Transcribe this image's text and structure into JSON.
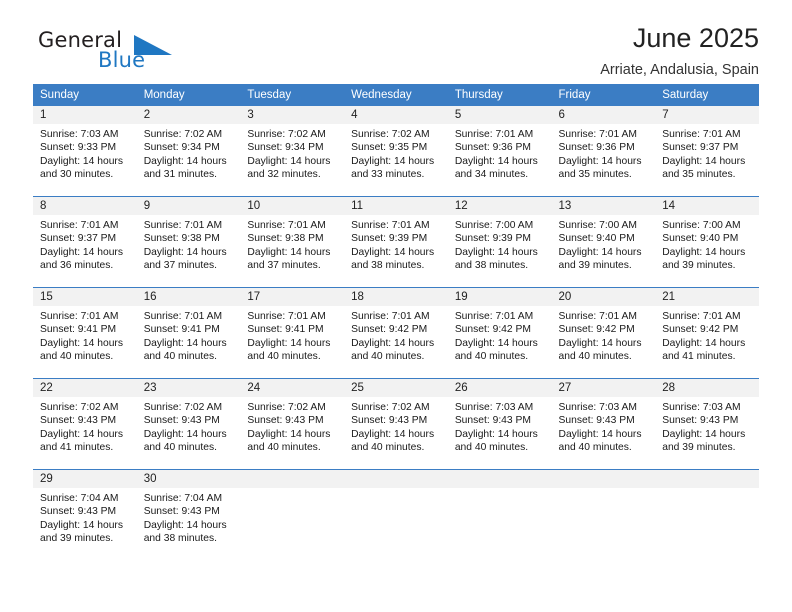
{
  "brand": {
    "name_part1": "General",
    "name_part2": "Blue",
    "triangle_color": "#1f77c2",
    "text_color": "#231f20"
  },
  "header": {
    "title": "June 2025",
    "subtitle": "Arriate, Andalusia, Spain"
  },
  "theme": {
    "header_bg": "#3b7dc4",
    "header_text": "#ffffff",
    "daynum_bg": "#f2f2f2",
    "row_divider": "#3b7dc4"
  },
  "weekdays": [
    "Sunday",
    "Monday",
    "Tuesday",
    "Wednesday",
    "Thursday",
    "Friday",
    "Saturday"
  ],
  "labels": {
    "sunrise_prefix": "Sunrise:",
    "sunset_prefix": "Sunset:",
    "daylight_prefix": "Daylight:"
  },
  "weeks": [
    [
      {
        "day": "1",
        "sunrise": "Sunrise: 7:03 AM",
        "sunset": "Sunset: 9:33 PM",
        "daylight_line1": "Daylight: 14 hours",
        "daylight_line2": "and 30 minutes."
      },
      {
        "day": "2",
        "sunrise": "Sunrise: 7:02 AM",
        "sunset": "Sunset: 9:34 PM",
        "daylight_line1": "Daylight: 14 hours",
        "daylight_line2": "and 31 minutes."
      },
      {
        "day": "3",
        "sunrise": "Sunrise: 7:02 AM",
        "sunset": "Sunset: 9:34 PM",
        "daylight_line1": "Daylight: 14 hours",
        "daylight_line2": "and 32 minutes."
      },
      {
        "day": "4",
        "sunrise": "Sunrise: 7:02 AM",
        "sunset": "Sunset: 9:35 PM",
        "daylight_line1": "Daylight: 14 hours",
        "daylight_line2": "and 33 minutes."
      },
      {
        "day": "5",
        "sunrise": "Sunrise: 7:01 AM",
        "sunset": "Sunset: 9:36 PM",
        "daylight_line1": "Daylight: 14 hours",
        "daylight_line2": "and 34 minutes."
      },
      {
        "day": "6",
        "sunrise": "Sunrise: 7:01 AM",
        "sunset": "Sunset: 9:36 PM",
        "daylight_line1": "Daylight: 14 hours",
        "daylight_line2": "and 35 minutes."
      },
      {
        "day": "7",
        "sunrise": "Sunrise: 7:01 AM",
        "sunset": "Sunset: 9:37 PM",
        "daylight_line1": "Daylight: 14 hours",
        "daylight_line2": "and 35 minutes."
      }
    ],
    [
      {
        "day": "8",
        "sunrise": "Sunrise: 7:01 AM",
        "sunset": "Sunset: 9:37 PM",
        "daylight_line1": "Daylight: 14 hours",
        "daylight_line2": "and 36 minutes."
      },
      {
        "day": "9",
        "sunrise": "Sunrise: 7:01 AM",
        "sunset": "Sunset: 9:38 PM",
        "daylight_line1": "Daylight: 14 hours",
        "daylight_line2": "and 37 minutes."
      },
      {
        "day": "10",
        "sunrise": "Sunrise: 7:01 AM",
        "sunset": "Sunset: 9:38 PM",
        "daylight_line1": "Daylight: 14 hours",
        "daylight_line2": "and 37 minutes."
      },
      {
        "day": "11",
        "sunrise": "Sunrise: 7:01 AM",
        "sunset": "Sunset: 9:39 PM",
        "daylight_line1": "Daylight: 14 hours",
        "daylight_line2": "and 38 minutes."
      },
      {
        "day": "12",
        "sunrise": "Sunrise: 7:00 AM",
        "sunset": "Sunset: 9:39 PM",
        "daylight_line1": "Daylight: 14 hours",
        "daylight_line2": "and 38 minutes."
      },
      {
        "day": "13",
        "sunrise": "Sunrise: 7:00 AM",
        "sunset": "Sunset: 9:40 PM",
        "daylight_line1": "Daylight: 14 hours",
        "daylight_line2": "and 39 minutes."
      },
      {
        "day": "14",
        "sunrise": "Sunrise: 7:00 AM",
        "sunset": "Sunset: 9:40 PM",
        "daylight_line1": "Daylight: 14 hours",
        "daylight_line2": "and 39 minutes."
      }
    ],
    [
      {
        "day": "15",
        "sunrise": "Sunrise: 7:01 AM",
        "sunset": "Sunset: 9:41 PM",
        "daylight_line1": "Daylight: 14 hours",
        "daylight_line2": "and 40 minutes."
      },
      {
        "day": "16",
        "sunrise": "Sunrise: 7:01 AM",
        "sunset": "Sunset: 9:41 PM",
        "daylight_line1": "Daylight: 14 hours",
        "daylight_line2": "and 40 minutes."
      },
      {
        "day": "17",
        "sunrise": "Sunrise: 7:01 AM",
        "sunset": "Sunset: 9:41 PM",
        "daylight_line1": "Daylight: 14 hours",
        "daylight_line2": "and 40 minutes."
      },
      {
        "day": "18",
        "sunrise": "Sunrise: 7:01 AM",
        "sunset": "Sunset: 9:42 PM",
        "daylight_line1": "Daylight: 14 hours",
        "daylight_line2": "and 40 minutes."
      },
      {
        "day": "19",
        "sunrise": "Sunrise: 7:01 AM",
        "sunset": "Sunset: 9:42 PM",
        "daylight_line1": "Daylight: 14 hours",
        "daylight_line2": "and 40 minutes."
      },
      {
        "day": "20",
        "sunrise": "Sunrise: 7:01 AM",
        "sunset": "Sunset: 9:42 PM",
        "daylight_line1": "Daylight: 14 hours",
        "daylight_line2": "and 40 minutes."
      },
      {
        "day": "21",
        "sunrise": "Sunrise: 7:01 AM",
        "sunset": "Sunset: 9:42 PM",
        "daylight_line1": "Daylight: 14 hours",
        "daylight_line2": "and 41 minutes."
      }
    ],
    [
      {
        "day": "22",
        "sunrise": "Sunrise: 7:02 AM",
        "sunset": "Sunset: 9:43 PM",
        "daylight_line1": "Daylight: 14 hours",
        "daylight_line2": "and 41 minutes."
      },
      {
        "day": "23",
        "sunrise": "Sunrise: 7:02 AM",
        "sunset": "Sunset: 9:43 PM",
        "daylight_line1": "Daylight: 14 hours",
        "daylight_line2": "and 40 minutes."
      },
      {
        "day": "24",
        "sunrise": "Sunrise: 7:02 AM",
        "sunset": "Sunset: 9:43 PM",
        "daylight_line1": "Daylight: 14 hours",
        "daylight_line2": "and 40 minutes."
      },
      {
        "day": "25",
        "sunrise": "Sunrise: 7:02 AM",
        "sunset": "Sunset: 9:43 PM",
        "daylight_line1": "Daylight: 14 hours",
        "daylight_line2": "and 40 minutes."
      },
      {
        "day": "26",
        "sunrise": "Sunrise: 7:03 AM",
        "sunset": "Sunset: 9:43 PM",
        "daylight_line1": "Daylight: 14 hours",
        "daylight_line2": "and 40 minutes."
      },
      {
        "day": "27",
        "sunrise": "Sunrise: 7:03 AM",
        "sunset": "Sunset: 9:43 PM",
        "daylight_line1": "Daylight: 14 hours",
        "daylight_line2": "and 40 minutes."
      },
      {
        "day": "28",
        "sunrise": "Sunrise: 7:03 AM",
        "sunset": "Sunset: 9:43 PM",
        "daylight_line1": "Daylight: 14 hours",
        "daylight_line2": "and 39 minutes."
      }
    ],
    [
      {
        "day": "29",
        "sunrise": "Sunrise: 7:04 AM",
        "sunset": "Sunset: 9:43 PM",
        "daylight_line1": "Daylight: 14 hours",
        "daylight_line2": "and 39 minutes."
      },
      {
        "day": "30",
        "sunrise": "Sunrise: 7:04 AM",
        "sunset": "Sunset: 9:43 PM",
        "daylight_line1": "Daylight: 14 hours",
        "daylight_line2": "and 38 minutes."
      },
      {
        "day": "",
        "sunrise": "",
        "sunset": "",
        "daylight_line1": "",
        "daylight_line2": ""
      },
      {
        "day": "",
        "sunrise": "",
        "sunset": "",
        "daylight_line1": "",
        "daylight_line2": ""
      },
      {
        "day": "",
        "sunrise": "",
        "sunset": "",
        "daylight_line1": "",
        "daylight_line2": ""
      },
      {
        "day": "",
        "sunrise": "",
        "sunset": "",
        "daylight_line1": "",
        "daylight_line2": ""
      },
      {
        "day": "",
        "sunrise": "",
        "sunset": "",
        "daylight_line1": "",
        "daylight_line2": ""
      }
    ]
  ]
}
